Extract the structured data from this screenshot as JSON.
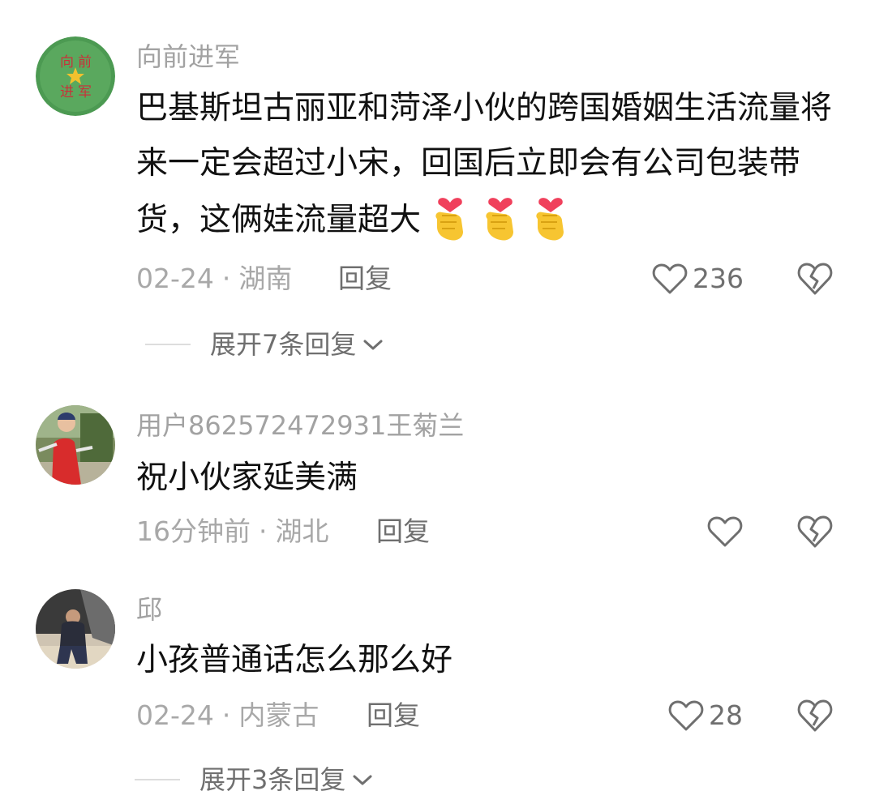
{
  "comments": [
    {
      "username": "向前进军",
      "avatar_icon": "army-emblem-avatar",
      "avatar_text": "向前进军",
      "text": "巴基斯坦古丽亚和菏泽小伙的跨国婚姻生活流量将来一定会超过小宋，回国后立即会有公司包装带货，这俩娃流量超大",
      "emojis": [
        "finger-heart-emoji",
        "finger-heart-emoji",
        "finger-heart-emoji"
      ],
      "date": "02-24",
      "separator": "·",
      "location": "湖南",
      "reply_label": "回复",
      "likes": "236",
      "expand_label": "展开7条回复"
    },
    {
      "username": "用户862572472931王菊兰",
      "avatar_icon": "woman-photo-avatar",
      "text": "祝小伙家延美满",
      "date": "16分钟前",
      "separator": "·",
      "location": "湖北",
      "reply_label": "回复",
      "likes": ""
    },
    {
      "username": "邱",
      "avatar_icon": "man-photo-avatar",
      "text": "小孩普通话怎么那么好",
      "date": "02-24",
      "separator": "·",
      "location": "内蒙古",
      "reply_label": "回复",
      "likes": "28",
      "expand_label": "展开3条回复"
    }
  ],
  "icons": {
    "like": "heart-outline-icon",
    "dislike": "broken-heart-icon",
    "expand": "chevron-down-icon"
  },
  "colors": {
    "username": "#a2a2a2",
    "text": "#111111",
    "meta": "#a8a8a8",
    "action": "#6f6f6f",
    "avatar_green": "#4c9a52"
  }
}
